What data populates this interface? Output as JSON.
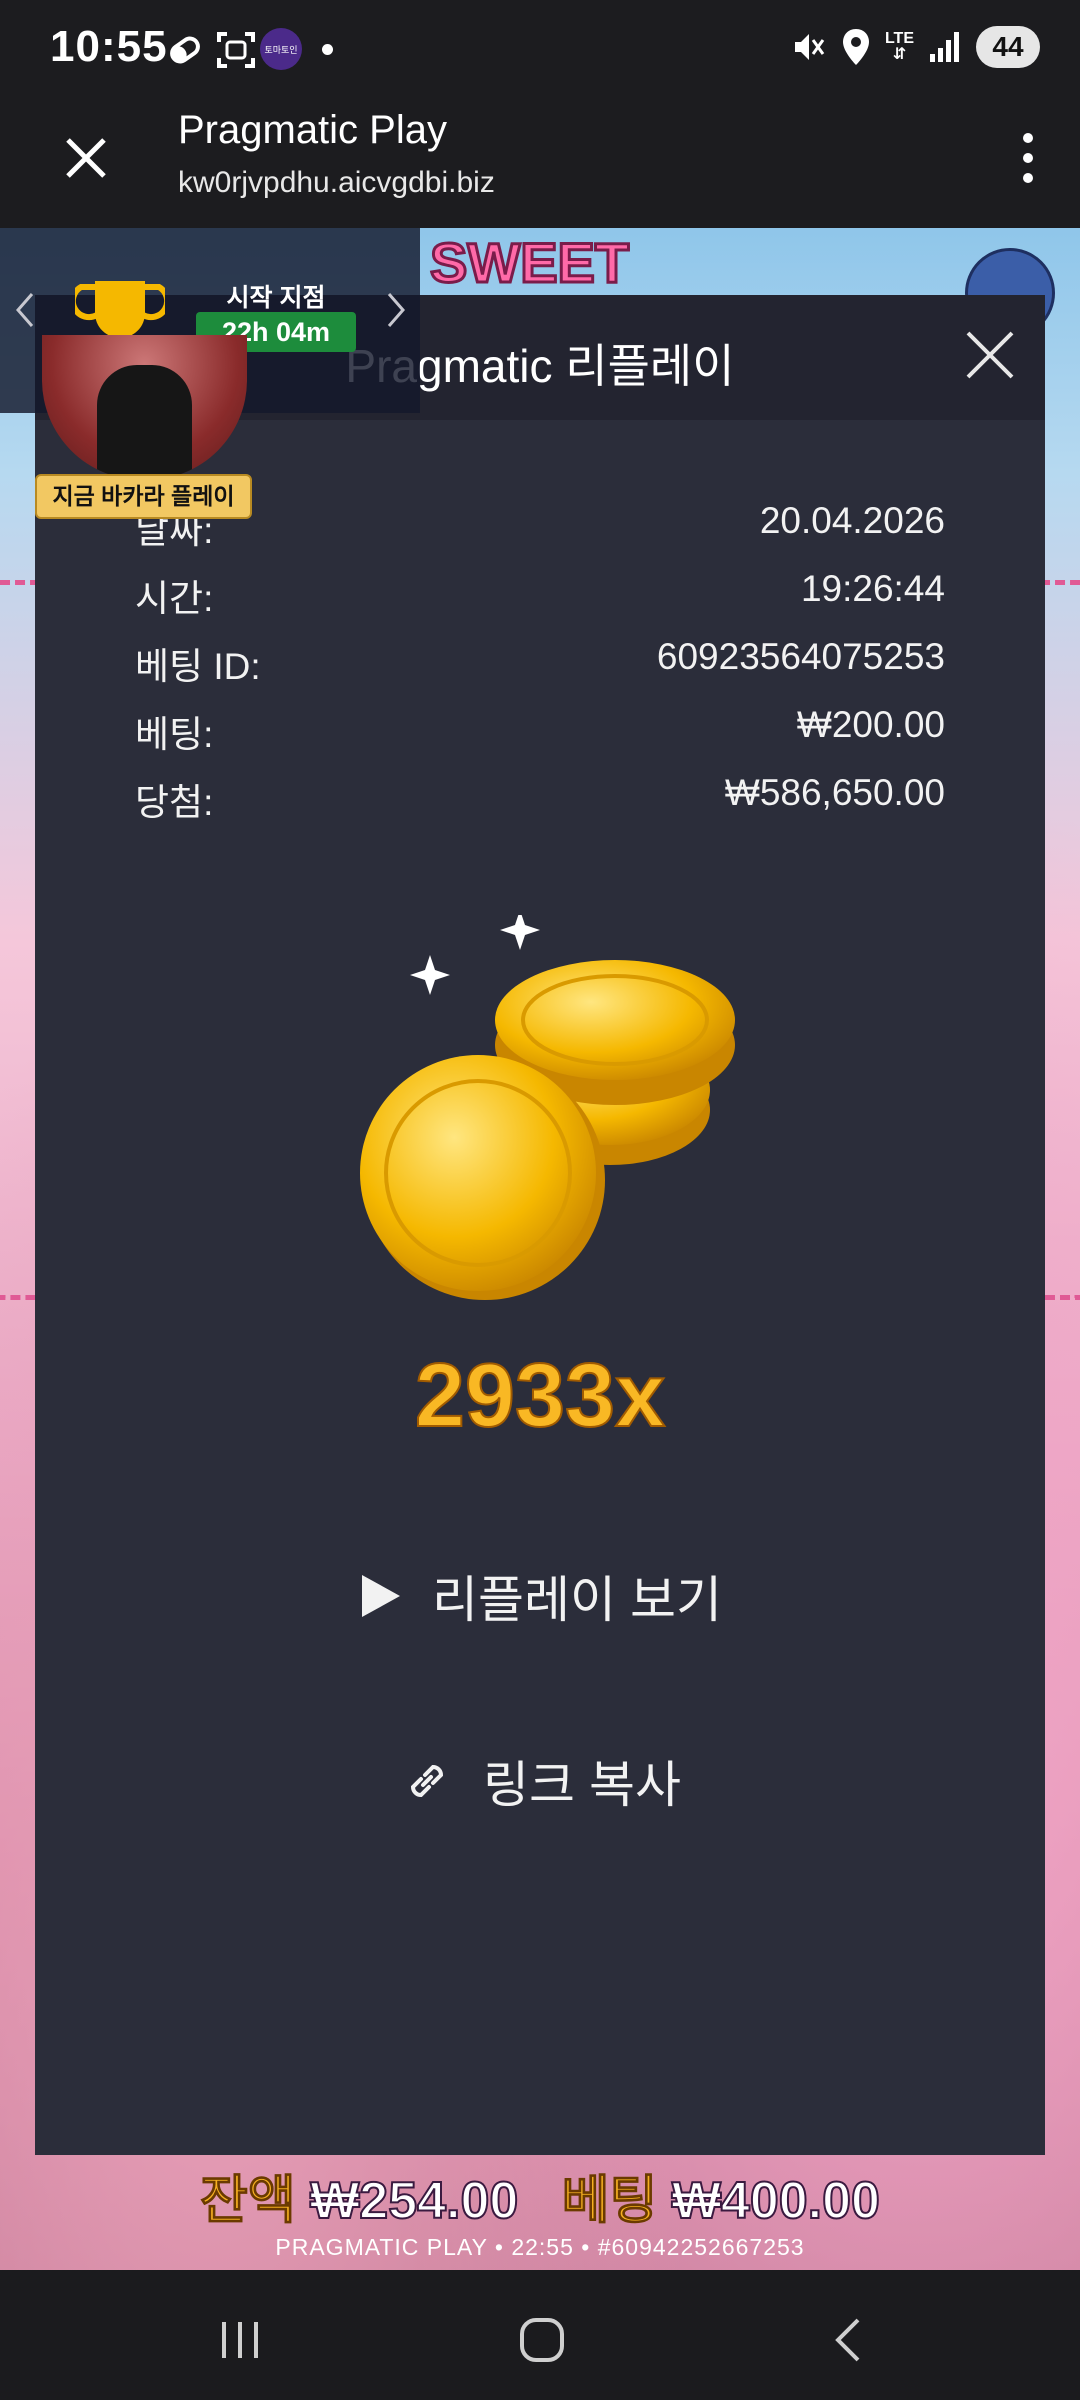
{
  "status_bar": {
    "time": "10:55",
    "app_badge": "토마토인",
    "network": "LTE",
    "battery": "44"
  },
  "browser": {
    "title": "Pragmatic Play",
    "url": "kw0rjvpdhu.aicvgdbi.biz"
  },
  "game": {
    "balance_label": "잔액",
    "balance_value": "₩254.00",
    "bet_label": "베팅",
    "bet_value": "₩400.00",
    "footer": "PRAGMATIC PLAY • 22:55 • #60942252667253",
    "logo_text": "SWEET"
  },
  "tournament": {
    "label": "시작 지점",
    "timer": "22h 04m",
    "promo": "지금 바카라 플레이"
  },
  "modal": {
    "title": "Pragmatic 리플레이",
    "rows": [
      {
        "label": "날짜:",
        "value": "20.04.2026"
      },
      {
        "label": "시간:",
        "value": "19:26:44"
      },
      {
        "label": "베팅 ID:",
        "value": "60923564075253"
      },
      {
        "label": "베팅:",
        "value": "₩200.00"
      },
      {
        "label": "당첨:",
        "value": "₩586,650.00"
      }
    ],
    "multiplier": "2933x",
    "replay_label": "리플레이 보기",
    "copy_label": "링크 복사"
  },
  "icons": {
    "close": "close-icon",
    "menu": "more-vert-icon",
    "play": "play-icon",
    "link": "link-icon",
    "trophy": "trophy-icon"
  },
  "colors": {
    "modal_bg": "#2b2d3a",
    "multiplier": "#f9b824",
    "timer_badge": "#1d8c3c",
    "balance_label": "#f6b021"
  }
}
